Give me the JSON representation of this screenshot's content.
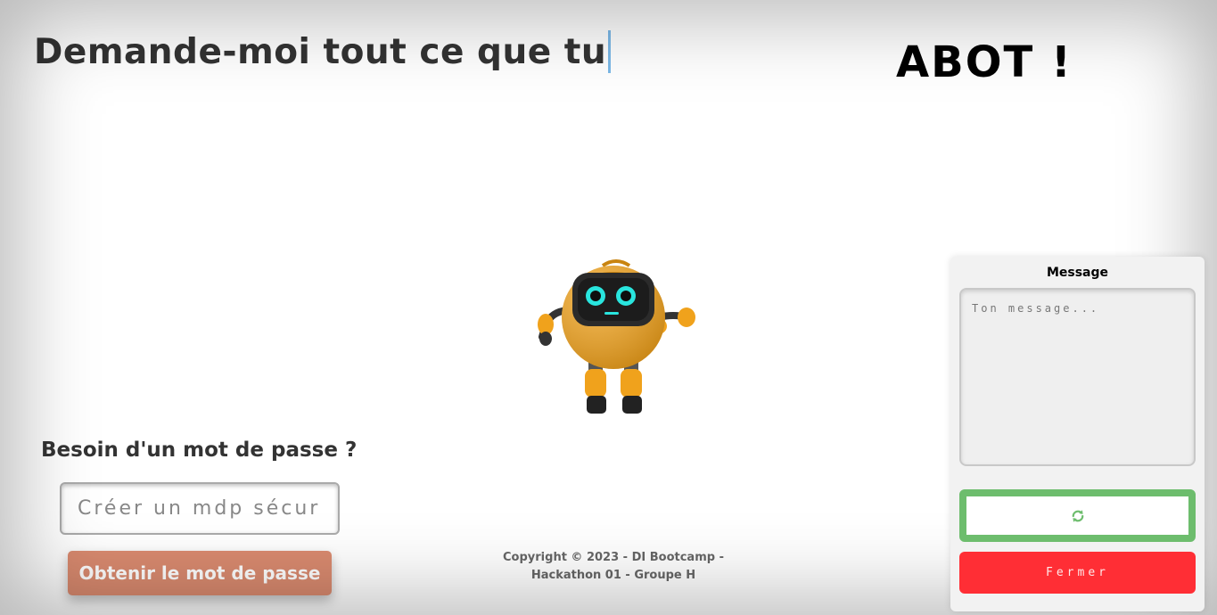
{
  "header": {
    "typed_title": "Demande-moi tout ce que tu",
    "brand": "ABOT !"
  },
  "robot": {
    "icon": "robot-icon",
    "body_color": "#f0a21c"
  },
  "password": {
    "title": "Besoin d'un mot de passe ?",
    "input_placeholder": "Créer un mdp sécurisé",
    "input_value": "",
    "button_label": "Obtenir le mot de passe",
    "button_color": "#d98a6f"
  },
  "footer": {
    "line1": "Copyright © 2023 - DI Bootcamp -",
    "line2": "Hackathon 01 - Groupe H"
  },
  "message_panel": {
    "label": "Message",
    "textarea_placeholder": "Ton message...",
    "textarea_value": "",
    "refresh_icon": "refresh-icon",
    "refresh_color": "#6dbd6d",
    "close_label": "Fermer",
    "close_color": "#ff2e35"
  }
}
